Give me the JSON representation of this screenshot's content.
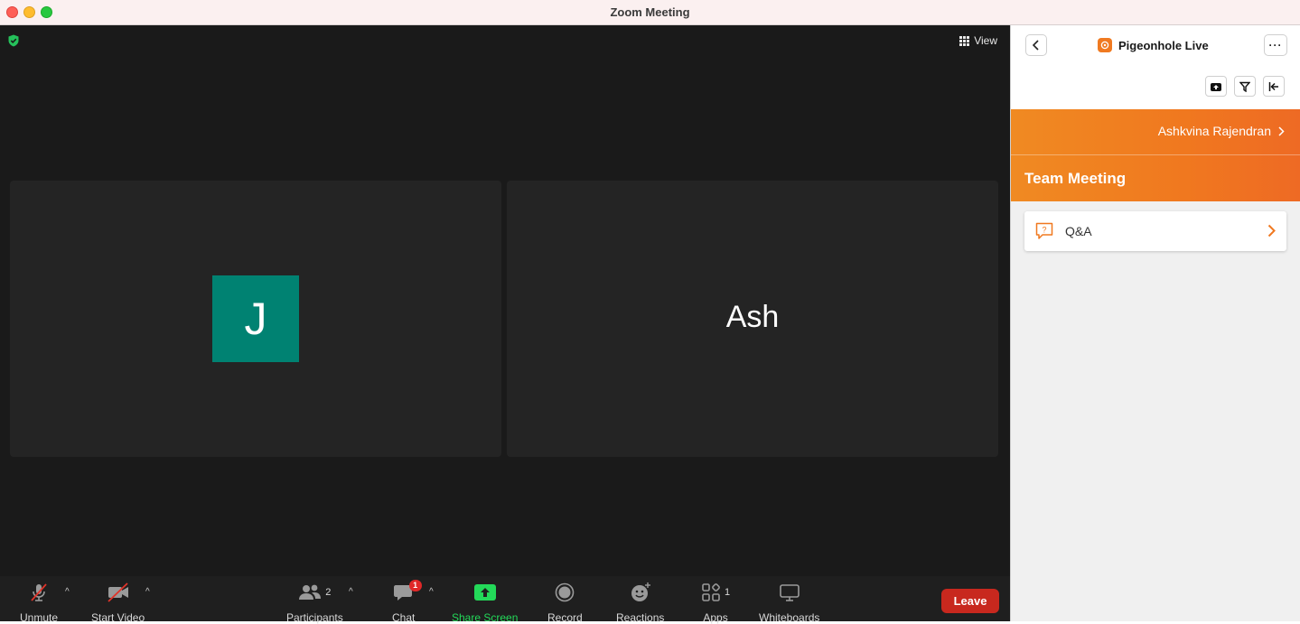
{
  "window": {
    "title": "Zoom Meeting"
  },
  "meeting": {
    "view_label": "View",
    "participants_tiles": [
      {
        "type": "avatar",
        "label": "J",
        "avatar_color": "#008272"
      },
      {
        "type": "name",
        "label": "Ash"
      }
    ]
  },
  "toolbar": {
    "unmute": "Unmute",
    "start_video": "Start Video",
    "participants": "Participants",
    "participants_count": "2",
    "chat": "Chat",
    "chat_badge": "1",
    "share_screen": "Share Screen",
    "record": "Record",
    "reactions": "Reactions",
    "apps": "Apps",
    "apps_count": "1",
    "whiteboards": "Whiteboards",
    "leave": "Leave"
  },
  "panel": {
    "app_name": "Pigeonhole Live",
    "more_label": "···",
    "user_name": "Ashkvina Rajendran",
    "meeting_title": "Team Meeting",
    "items": [
      {
        "label": "Q&A"
      }
    ],
    "accent_color": "#f0781f"
  },
  "icons": {
    "security": "shield-check-icon",
    "view": "grid-icon",
    "back": "chevron-left-icon",
    "more": "ellipsis-icon",
    "upload": "upload-icon",
    "filter": "filter-icon",
    "collapse": "collapse-left-icon",
    "qa": "question-bubble-icon"
  },
  "colors": {
    "share_green": "#23d959",
    "leave_red": "#c8281e",
    "meeting_bg": "#1a1a1a"
  }
}
